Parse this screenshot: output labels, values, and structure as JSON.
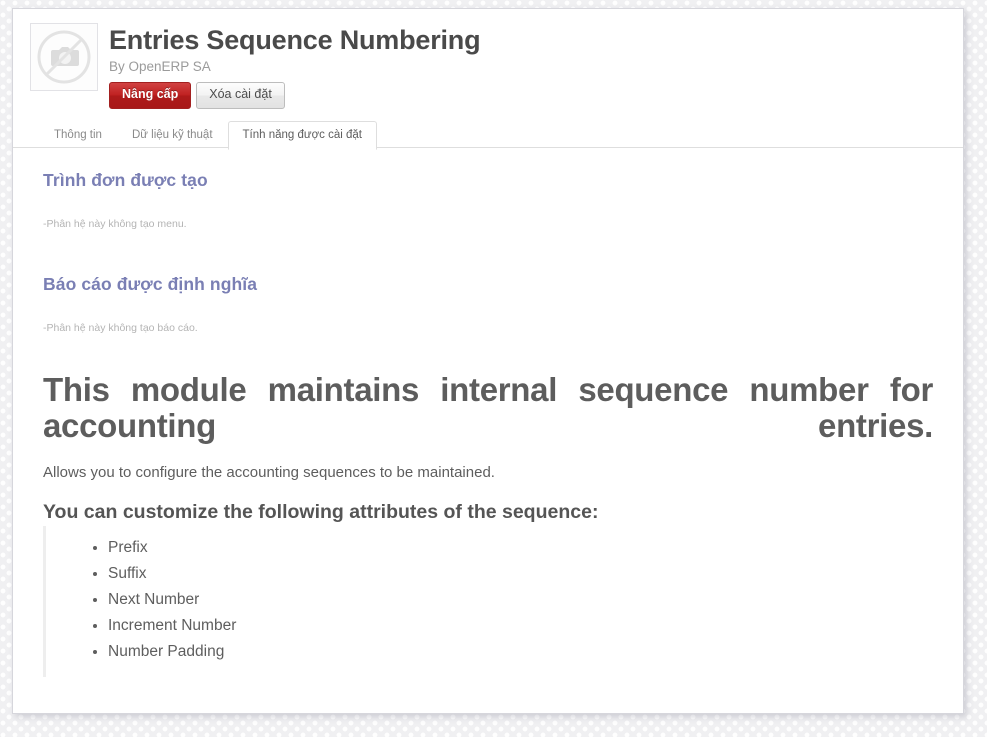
{
  "module": {
    "title": "Entries Sequence Numbering",
    "author": "By OpenERP SA",
    "thumbnail_icon": "no-image-camera-icon"
  },
  "actions": {
    "upgrade_label": "Nâng cấp",
    "uninstall_label": "Xóa cài đặt",
    "upgrade_color": "#bf2020",
    "uninstall_color": "#e9e9e9"
  },
  "tabs": [
    {
      "label": "Thông tin",
      "active": false
    },
    {
      "label": "Dữ liệu kỹ thuật",
      "active": false
    },
    {
      "label": "Tính năng được cài đặt",
      "active": true
    }
  ],
  "sections": [
    {
      "heading": "Trình đơn được tạo",
      "note": "-Phân hệ này không tạo menu."
    },
    {
      "heading": "Báo cáo được định nghĩa",
      "note": "-Phân hệ này không tạo báo cáo."
    }
  ],
  "description": {
    "title": "This module maintains internal sequence number for accounting entries.",
    "paragraph": "Allows you to configure the accounting sequences to be maintained.",
    "subtitle": "You can customize the following attributes of the sequence:",
    "attributes": [
      "Prefix",
      "Suffix",
      "Next Number",
      "Increment Number",
      "Number Padding"
    ]
  },
  "theme": {
    "heading_color": "#7a7fb4",
    "text_color": "#5e5e5e",
    "muted_color": "#b4b4b4",
    "card_background": "#ffffff"
  }
}
